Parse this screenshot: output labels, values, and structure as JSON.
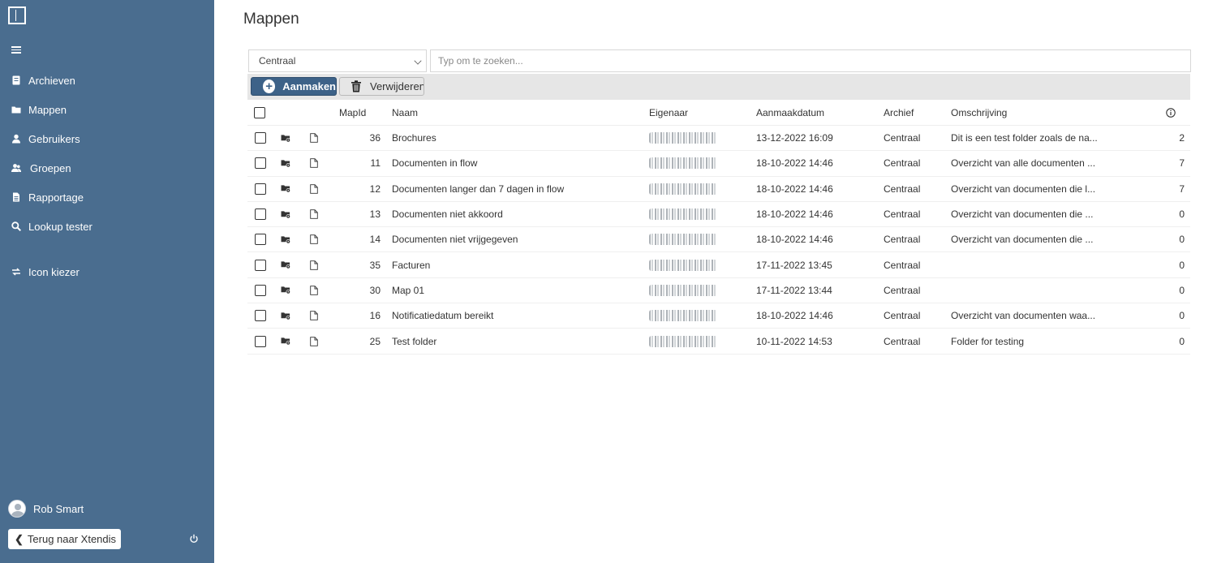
{
  "page": {
    "title": "Mappen"
  },
  "sidebar": {
    "items": [
      {
        "label": "Archieven",
        "icon": "archive-icon"
      },
      {
        "label": "Mappen",
        "icon": "folder-icon"
      },
      {
        "label": "Gebruikers",
        "icon": "user-icon"
      },
      {
        "label": "Groepen",
        "icon": "users-icon"
      },
      {
        "label": "Rapportage",
        "icon": "report-icon"
      },
      {
        "label": "Lookup tester",
        "icon": "search-icon"
      },
      {
        "label": "Icon kiezer",
        "icon": "swap-icon"
      }
    ],
    "user_name": "Rob Smart",
    "back_label": "Terug naar Xtendis"
  },
  "filters": {
    "archive_selected": "Centraal",
    "search_placeholder": "Typ om te zoeken..."
  },
  "toolbar": {
    "create_label": "Aanmaken",
    "delete_label": "Verwijderen"
  },
  "table": {
    "headers": {
      "mapid": "MapId",
      "name": "Naam",
      "owner": "Eigenaar",
      "date": "Aanmaakdatum",
      "archive": "Archief",
      "description": "Omschrijving"
    },
    "rows": [
      {
        "id": "36",
        "name": "Brochures",
        "date": "13-12-2022 16:09",
        "archive": "Centraal",
        "description": "Dit is een test folder zoals de na...",
        "count": "2"
      },
      {
        "id": "11",
        "name": "Documenten in flow",
        "date": "18-10-2022 14:46",
        "archive": "Centraal",
        "description": "Overzicht van alle documenten ...",
        "count": "7"
      },
      {
        "id": "12",
        "name": "Documenten langer dan 7 dagen in flow",
        "date": "18-10-2022 14:46",
        "archive": "Centraal",
        "description": "Overzicht van documenten die l...",
        "count": "7"
      },
      {
        "id": "13",
        "name": "Documenten niet akkoord",
        "date": "18-10-2022 14:46",
        "archive": "Centraal",
        "description": "Overzicht van documenten die ...",
        "count": "0"
      },
      {
        "id": "14",
        "name": "Documenten niet vrijgegeven",
        "date": "18-10-2022 14:46",
        "archive": "Centraal",
        "description": "Overzicht van documenten die ...",
        "count": "0"
      },
      {
        "id": "35",
        "name": "Facturen",
        "date": "17-11-2022 13:45",
        "archive": "Centraal",
        "description": "",
        "count": "0"
      },
      {
        "id": "30",
        "name": "Map 01",
        "date": "17-11-2022 13:44",
        "archive": "Centraal",
        "description": "",
        "count": "0"
      },
      {
        "id": "16",
        "name": "Notificatiedatum bereikt",
        "date": "18-10-2022 14:46",
        "archive": "Centraal",
        "description": "Overzicht van documenten waa...",
        "count": "0"
      },
      {
        "id": "25",
        "name": "Test folder",
        "date": "10-11-2022 14:53",
        "archive": "Centraal",
        "description": "Folder for testing",
        "count": "0"
      }
    ]
  },
  "colors": {
    "sidebar_bg": "#4a6d8f",
    "primary_button": "#3d6288",
    "toolbar_bg": "#e6e6e6"
  }
}
